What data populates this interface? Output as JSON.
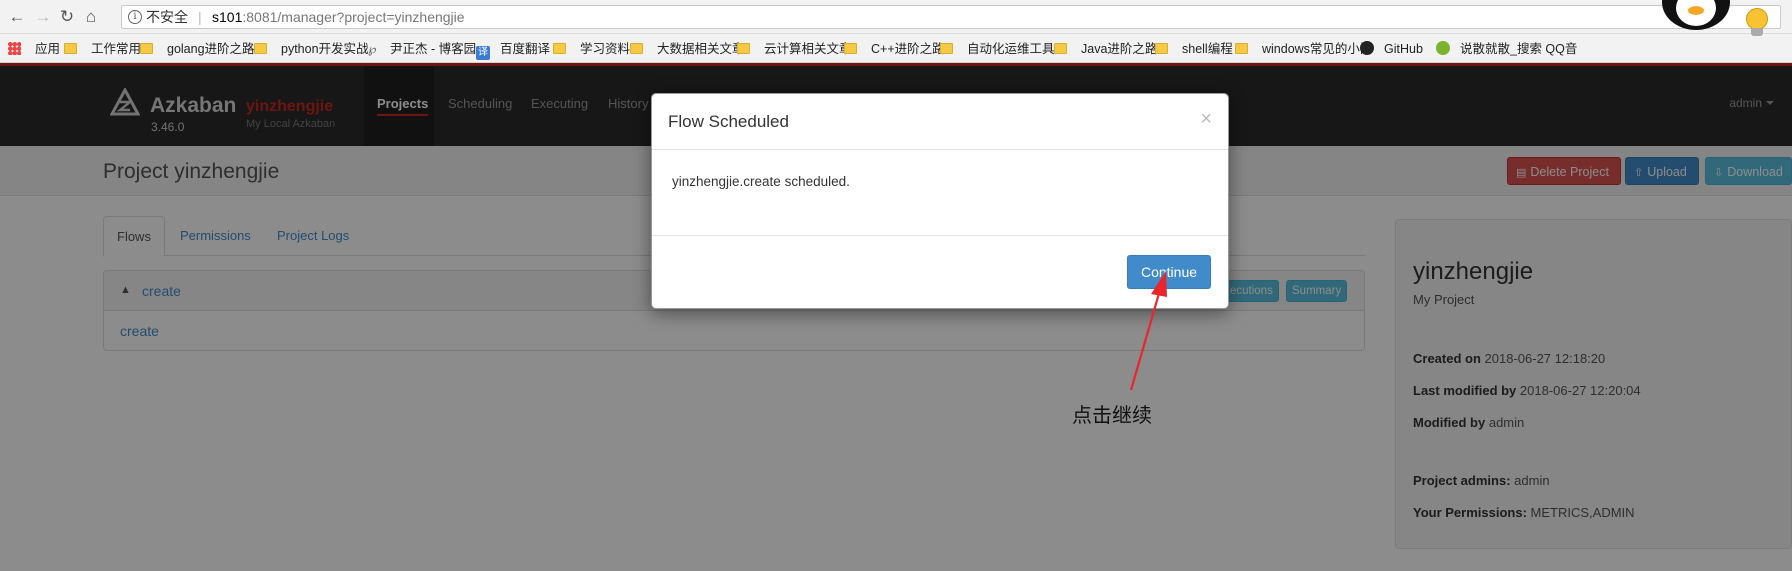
{
  "browser": {
    "insecure_label": "不安全",
    "url_host": "s101",
    "url_rest": ":8081/manager?project=yinzhengjie",
    "bookmarks": [
      {
        "label": "应用",
        "icon": "apps-icon"
      },
      {
        "label": "工作常用",
        "icon": "folder-icon"
      },
      {
        "label": "golang进阶之路",
        "icon": "folder-icon"
      },
      {
        "label": "python开发实战",
        "icon": "folder-icon"
      },
      {
        "label": "尹正杰 - 博客园",
        "icon": "blog-icon"
      },
      {
        "label": "百度翻译",
        "icon": "translate-icon"
      },
      {
        "label": "学习资料",
        "icon": "folder-icon"
      },
      {
        "label": "大数据相关文章",
        "icon": "folder-icon"
      },
      {
        "label": "云计算相关文章",
        "icon": "folder-icon"
      },
      {
        "label": "C++进阶之路",
        "icon": "folder-icon"
      },
      {
        "label": "自动化运维工具",
        "icon": "folder-icon"
      },
      {
        "label": "Java进阶之路",
        "icon": "folder-icon"
      },
      {
        "label": "shell编程",
        "icon": "folder-icon"
      },
      {
        "label": "windows常见的小问",
        "icon": "folder-icon"
      },
      {
        "label": "GitHub",
        "icon": "github-icon"
      },
      {
        "label": "说散就散_搜索 QQ音",
        "icon": "search-icon"
      }
    ],
    "translate_glyph": "译"
  },
  "header": {
    "brand": "Azkaban",
    "project": "yinzhengjie",
    "version": "3.46.0",
    "subtitle": "My Local Azkaban",
    "nav": [
      "Projects",
      "Scheduling",
      "Executing",
      "History"
    ],
    "user": "admin"
  },
  "titlebar": {
    "title": "Project yinzhengjie",
    "delete_label": "Delete Project",
    "upload_label": "Upload",
    "download_label": "Download"
  },
  "tabs": [
    "Flows",
    "Permissions",
    "Project Logs"
  ],
  "flow": {
    "name": "create",
    "executions_label": "ecutions",
    "summary_label": "Summary",
    "body_link": "create"
  },
  "side": {
    "name": "yinzhengjie",
    "description": "My Project",
    "created_label": "Created on",
    "created_value": "2018-06-27 12:18:20",
    "modified_label": "Last modified by",
    "modified_value": "2018-06-27 12:20:04",
    "modified_by_label": "Modified by",
    "modified_by_value": "admin",
    "admins_label": "Project admins:",
    "admins_value": "admin",
    "perms_label": "Your Permissions:",
    "perms_value": "METRICS,ADMIN"
  },
  "modal": {
    "title": "Flow Scheduled",
    "close": "×",
    "message": "yinzhengjie.create scheduled.",
    "continue_label": "Continue"
  },
  "annotation": {
    "text": "点击继续",
    "color": "#e8262b"
  },
  "colors": {
    "brand_red": "#c7281f",
    "primary": "#428bca",
    "danger": "#d9534f",
    "info": "#5bc0de"
  }
}
